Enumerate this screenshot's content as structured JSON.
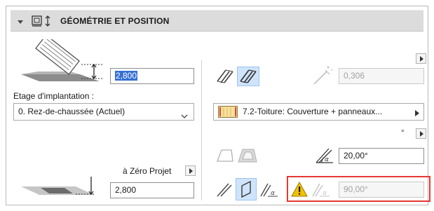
{
  "header": {
    "title": "GÉOMÉTRIE ET POSITION",
    "collapse_icon": "chevron-down-icon",
    "section_icon": "geometry-position-icon"
  },
  "left": {
    "thickness_value": "2,800",
    "story_label": "Etage d'implantation :",
    "story_value": "0. Rez-de-chaussée (Actuel)",
    "zero_label": "à Zéro Projet",
    "zero_value": "2,800"
  },
  "right": {
    "pitch_value": "0,306",
    "material_label": "7.2-Toiture: Couverture + panneaux...",
    "degree_mark": "°",
    "angle_value": "20,00°",
    "edge_angle_value": "90,00°"
  },
  "colors": {
    "header_bg": "#dcdcdc",
    "selection": "#3470d4",
    "active_icon_bg": "#cfe4fb",
    "warning": "#f2c200",
    "highlight_border": "#e53935"
  }
}
